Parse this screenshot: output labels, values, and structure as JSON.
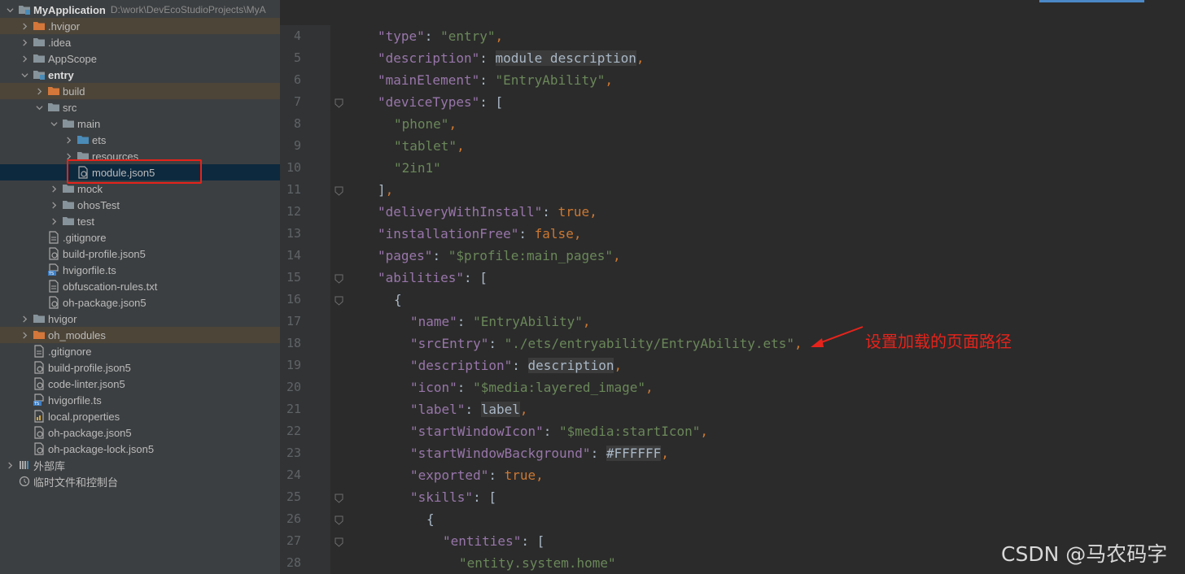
{
  "project_tree": {
    "rows": [
      {
        "label": "MyApplication",
        "path": "D:\\work\\DevEcoStudioProjects\\MyA"
      },
      {
        "label": ".hvigor"
      },
      {
        "label": ".idea"
      },
      {
        "label": "AppScope"
      },
      {
        "label": "entry"
      },
      {
        "label": "build"
      },
      {
        "label": "src"
      },
      {
        "label": "main"
      },
      {
        "label": "ets"
      },
      {
        "label": "resources"
      },
      {
        "label": "module.json5"
      },
      {
        "label": "mock"
      },
      {
        "label": "ohosTest"
      },
      {
        "label": "test"
      },
      {
        "label": ".gitignore"
      },
      {
        "label": "build-profile.json5"
      },
      {
        "label": "hvigorfile.ts"
      },
      {
        "label": "obfuscation-rules.txt"
      },
      {
        "label": "oh-package.json5"
      },
      {
        "label": "hvigor"
      },
      {
        "label": "oh_modules"
      },
      {
        "label": ".gitignore"
      },
      {
        "label": "build-profile.json5"
      },
      {
        "label": "code-linter.json5"
      },
      {
        "label": "hvigorfile.ts"
      },
      {
        "label": "local.properties"
      },
      {
        "label": "oh-package.json5"
      },
      {
        "label": "oh-package-lock.json5"
      },
      {
        "label": "外部库"
      },
      {
        "label": "临时文件和控制台"
      }
    ]
  },
  "editor": {
    "line_numbers": [
      "4",
      "5",
      "6",
      "7",
      "8",
      "9",
      "10",
      "11",
      "12",
      "13",
      "14",
      "15",
      "16",
      "17",
      "18",
      "19",
      "20",
      "21",
      "22",
      "23",
      "24",
      "25",
      "26",
      "27",
      "28"
    ],
    "lines": [
      [
        {
          "t": "k",
          "v": "\"type\""
        },
        {
          "t": "d",
          "v": ": "
        },
        {
          "t": "s",
          "v": "\"entry\""
        },
        {
          "t": "p",
          "v": ","
        }
      ],
      [
        {
          "t": "k",
          "v": "\"description\""
        },
        {
          "t": "d",
          "v": ": "
        },
        {
          "t": "pl",
          "v": "module description"
        },
        {
          "t": "p",
          "v": ","
        }
      ],
      [
        {
          "t": "k",
          "v": "\"mainElement\""
        },
        {
          "t": "d",
          "v": ": "
        },
        {
          "t": "s",
          "v": "\"EntryAbility\""
        },
        {
          "t": "p",
          "v": ","
        }
      ],
      [
        {
          "t": "k",
          "v": "\"deviceTypes\""
        },
        {
          "t": "d",
          "v": ": ["
        }
      ],
      [
        {
          "t": "s",
          "v": "\"phone\""
        },
        {
          "t": "p",
          "v": ","
        }
      ],
      [
        {
          "t": "s",
          "v": "\"tablet\""
        },
        {
          "t": "p",
          "v": ","
        }
      ],
      [
        {
          "t": "s",
          "v": "\"2in1\""
        }
      ],
      [
        {
          "t": "d",
          "v": "]"
        },
        {
          "t": "p",
          "v": ","
        }
      ],
      [
        {
          "t": "k",
          "v": "\"deliveryWithInstall\""
        },
        {
          "t": "d",
          "v": ": "
        },
        {
          "t": "p",
          "v": "true,"
        }
      ],
      [
        {
          "t": "k",
          "v": "\"installationFree\""
        },
        {
          "t": "d",
          "v": ": "
        },
        {
          "t": "p",
          "v": "false,"
        }
      ],
      [
        {
          "t": "k",
          "v": "\"pages\""
        },
        {
          "t": "d",
          "v": ": "
        },
        {
          "t": "s",
          "v": "\"$profile:main_pages\""
        },
        {
          "t": "p",
          "v": ","
        }
      ],
      [
        {
          "t": "k",
          "v": "\"abilities\""
        },
        {
          "t": "d",
          "v": ": ["
        }
      ],
      [
        {
          "t": "d",
          "v": "{"
        }
      ],
      [
        {
          "t": "k",
          "v": "\"name\""
        },
        {
          "t": "d",
          "v": ": "
        },
        {
          "t": "s",
          "v": "\"EntryAbility\""
        },
        {
          "t": "p",
          "v": ","
        }
      ],
      [
        {
          "t": "k",
          "v": "\"srcEntry\""
        },
        {
          "t": "d",
          "v": ": "
        },
        {
          "t": "s",
          "v": "\"./ets/entryability/EntryAbility.ets\""
        },
        {
          "t": "p",
          "v": ","
        }
      ],
      [
        {
          "t": "k",
          "v": "\"description\""
        },
        {
          "t": "d",
          "v": ": "
        },
        {
          "t": "pl",
          "v": "description"
        },
        {
          "t": "p",
          "v": ","
        }
      ],
      [
        {
          "t": "k",
          "v": "\"icon\""
        },
        {
          "t": "d",
          "v": ": "
        },
        {
          "t": "s",
          "v": "\"$media:layered_image\""
        },
        {
          "t": "p",
          "v": ","
        }
      ],
      [
        {
          "t": "k",
          "v": "\"label\""
        },
        {
          "t": "d",
          "v": ": "
        },
        {
          "t": "pl",
          "v": "label"
        },
        {
          "t": "p",
          "v": ","
        }
      ],
      [
        {
          "t": "k",
          "v": "\"startWindowIcon\""
        },
        {
          "t": "d",
          "v": ": "
        },
        {
          "t": "s",
          "v": "\"$media:startIcon\""
        },
        {
          "t": "p",
          "v": ","
        }
      ],
      [
        {
          "t": "k",
          "v": "\"startWindowBackground\""
        },
        {
          "t": "d",
          "v": ": "
        },
        {
          "t": "pl",
          "v": "#FFFFFF"
        },
        {
          "t": "p",
          "v": ","
        }
      ],
      [
        {
          "t": "k",
          "v": "\"exported\""
        },
        {
          "t": "d",
          "v": ": "
        },
        {
          "t": "p",
          "v": "true,"
        }
      ],
      [
        {
          "t": "k",
          "v": "\"skills\""
        },
        {
          "t": "d",
          "v": ": ["
        }
      ],
      [
        {
          "t": "d",
          "v": "{"
        }
      ],
      [
        {
          "t": "k",
          "v": "\"entities\""
        },
        {
          "t": "d",
          "v": ": ["
        }
      ],
      [
        {
          "t": "s",
          "v": "\"entity.system.home\""
        }
      ]
    ]
  },
  "annotation": {
    "text": "设置加载的页面路径"
  },
  "watermark": {
    "text": "CSDN @马农码字"
  },
  "colors": {
    "annotation_red": "#e5231b",
    "json_key": "#9876aa",
    "json_string": "#6a8759",
    "json_keyword": "#cc7832"
  }
}
